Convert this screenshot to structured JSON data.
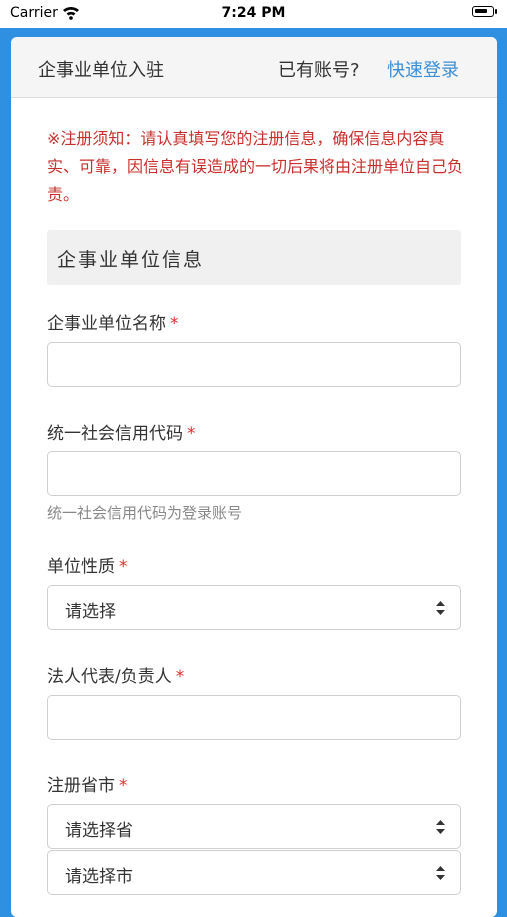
{
  "status_bar": {
    "carrier": "Carrier",
    "time": "7:24 PM"
  },
  "header": {
    "title": "企事业单位入驻",
    "have_account": "已有账号?",
    "login_link": "快速登录"
  },
  "notice": "※注册须知：请认真填写您的注册信息，确保信息内容真实、可靠，因信息有误造成的一切后果将由注册单位自己负责。",
  "section_title": "企事业单位信息",
  "fields": {
    "org_name": {
      "label": "企事业单位名称",
      "required": "*"
    },
    "credit_code": {
      "label": "统一社会信用代码",
      "required": "*",
      "help": "统一社会信用代码为登录账号"
    },
    "org_type": {
      "label": "单位性质",
      "required": "*",
      "selected": "请选择"
    },
    "legal_rep": {
      "label": "法人代表/负责人",
      "required": "*"
    },
    "region": {
      "label": "注册省市",
      "required": "*",
      "province_selected": "请选择省",
      "city_selected": "请选择市"
    }
  },
  "colors": {
    "accent": "#3b8fd8",
    "warning": "#c9302c",
    "background": "#2f8fe0"
  }
}
